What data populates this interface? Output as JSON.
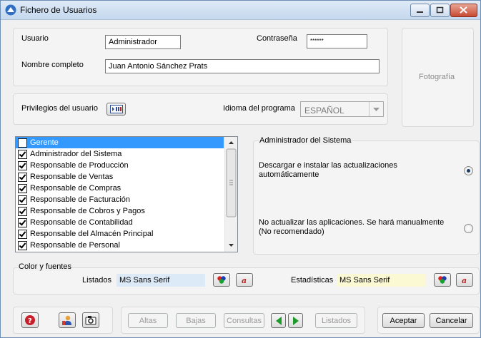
{
  "window": {
    "title": "Fichero de Usuarios"
  },
  "user": {
    "usuario_label": "Usuario",
    "usuario_value": "Administrador",
    "password_label": "Contraseña",
    "password_value": "******",
    "nombre_label": "Nombre completo",
    "nombre_value": "Juan Antonio Sánchez Prats",
    "photo_label": "Fotografía"
  },
  "privileges": {
    "label": "Privilegios del usuario",
    "idioma_label": "Idioma del programa",
    "idioma_value": "ESPAÑOL"
  },
  "roles": [
    {
      "label": "Gerente",
      "checked": false,
      "selected": true
    },
    {
      "label": "Administrador del Sistema",
      "checked": true,
      "selected": false
    },
    {
      "label": "Responsable de Producción",
      "checked": true,
      "selected": false
    },
    {
      "label": "Responsable de Ventas",
      "checked": true,
      "selected": false
    },
    {
      "label": "Responsable de Compras",
      "checked": true,
      "selected": false
    },
    {
      "label": "Responsable de Facturación",
      "checked": true,
      "selected": false
    },
    {
      "label": "Responsable de Cobros y Pagos",
      "checked": true,
      "selected": false
    },
    {
      "label": "Responsable de Contabilidad",
      "checked": true,
      "selected": false
    },
    {
      "label": "Responsable del Almacén Principal",
      "checked": true,
      "selected": false
    },
    {
      "label": "Responsable de Personal",
      "checked": true,
      "selected": false
    }
  ],
  "admin": {
    "title": "Administrador del Sistema",
    "opt1_line1": "Descargar e instalar las actualizaciones",
    "opt1_line2": "automáticamente",
    "opt2_line1": "No actualizar las aplicaciones. Se hará manualmente",
    "opt2_line2": "(No recomendado)",
    "selected_option": 1
  },
  "fonts": {
    "title": "Color y fuentes",
    "listados_label": "Listados",
    "listados_value": "MS Sans Serif",
    "estadisticas_label": "Estadísticas",
    "estadisticas_value": "MS Sans Serif"
  },
  "toolbar": {
    "altas": "Altas",
    "bajas": "Bajas",
    "consultas": "Consultas",
    "listados": "Listados",
    "aceptar": "Aceptar",
    "cancelar": "Cancelar"
  },
  "colors": {
    "selection": "#3399ff",
    "listados_bg": "#dce9f7",
    "estadisticas_bg": "#fbf8d4"
  }
}
